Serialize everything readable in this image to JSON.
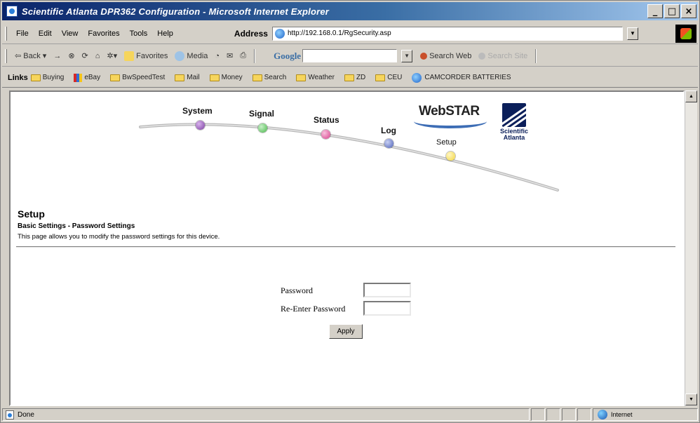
{
  "window": {
    "title": "Scientific Atlanta DPR362 Configuration - Microsoft Internet Explorer",
    "buttons": {
      "minimize": "_",
      "maximize": "□",
      "close": "×"
    }
  },
  "menubar": {
    "items": [
      "File",
      "Edit",
      "View",
      "Favorites",
      "Tools",
      "Help"
    ],
    "address_label": "Address",
    "address_value": "http://192.168.0.1/RgSecurity.asp"
  },
  "toolbar": {
    "back": "Back",
    "forward": "→",
    "favorites": "Favorites",
    "media": "Media",
    "google": "Google",
    "search_web": "Search Web",
    "search_site": "Search Site"
  },
  "links": {
    "label": "Links",
    "items": [
      "Buying",
      "eBay",
      "BwSpeedTest",
      "Mail",
      "Money",
      "Search",
      "Weather",
      "ZD",
      "CEU",
      "CAMCORDER BATTERIES"
    ]
  },
  "nav": {
    "system": "System",
    "signal": "Signal",
    "status": "Status",
    "log": "Log",
    "setup": "Setup",
    "webstar": "WebSTAR",
    "sa_line1": "Scientific",
    "sa_line2": "Atlanta",
    "colors": {
      "system": "#7b3fa0",
      "signal": "#49b84a",
      "status": "#d8408c",
      "log": "#4b5fb8",
      "setup": "#f2d53c"
    }
  },
  "page": {
    "title": "Setup",
    "subtitle": "Basic Settings - Password Settings",
    "description": "This page allows you to modify the password settings for this device."
  },
  "form": {
    "password_label": "Password",
    "reenter_label": "Re-Enter Password",
    "apply": "Apply"
  },
  "statusbar": {
    "status": "Done",
    "zone": "Internet"
  }
}
